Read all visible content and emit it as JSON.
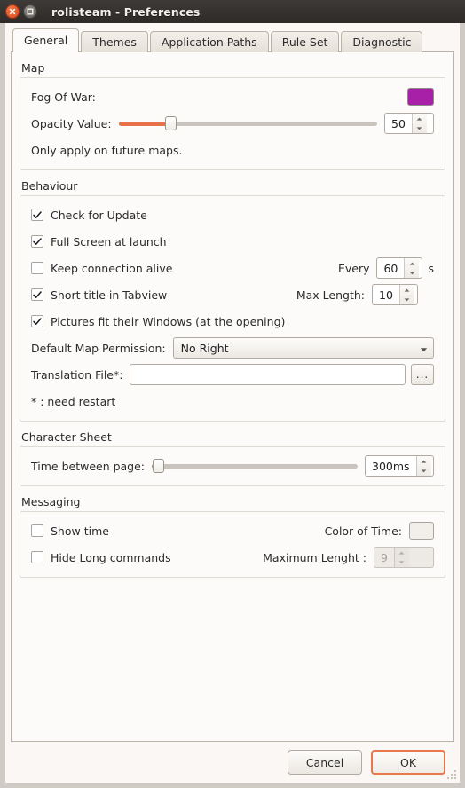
{
  "window": {
    "title": "rolisteam - Preferences",
    "close_icon": "close-icon",
    "restore_icon": "restore-icon"
  },
  "tabs": [
    {
      "label": "General",
      "active": true
    },
    {
      "label": "Themes",
      "active": false
    },
    {
      "label": "Application Paths",
      "active": false
    },
    {
      "label": "Rule Set",
      "active": false
    },
    {
      "label": "Diagnostic",
      "active": false
    }
  ],
  "colors": {
    "fog_of_war": "#a81fa8",
    "color_of_time": "#f2efeb",
    "slider_fill": "#e8714a",
    "default_button_border": "#e8794f"
  },
  "map": {
    "group_title": "Map",
    "fog_of_war_label": "Fog Of War:",
    "opacity_label": "Opacity Value:",
    "opacity_value": "50",
    "opacity_percent": 20,
    "note": "Only apply on future maps."
  },
  "behaviour": {
    "group_title": "Behaviour",
    "check_for_update": {
      "label": "Check for Update",
      "checked": true
    },
    "full_screen": {
      "label": "Full Screen at launch",
      "checked": true
    },
    "keep_alive": {
      "label": "Keep connection alive",
      "checked": false
    },
    "keep_alive_every_label": "Every",
    "keep_alive_value": "60",
    "keep_alive_unit": "s",
    "short_title": {
      "label": "Short title in Tabview",
      "checked": true
    },
    "max_length_label": "Max Length:",
    "max_length_value": "10",
    "pictures_fit": {
      "label": "Pictures fit their Windows (at the opening)",
      "checked": true
    },
    "permission_label": "Default Map Permission:",
    "permission_value": "No Right",
    "permission_options": [
      "No Right"
    ],
    "translation_label": "Translation File*:",
    "translation_value": "",
    "translation_placeholder": "",
    "browse_label": "...",
    "restart_note": "* : need restart"
  },
  "character_sheet": {
    "group_title": "Character Sheet",
    "time_label": "Time between page:",
    "time_value": "300ms",
    "time_percent": 3
  },
  "messaging": {
    "group_title": "Messaging",
    "show_time": {
      "label": "Show time",
      "checked": false
    },
    "color_of_time_label": "Color of Time:",
    "hide_long_commands": {
      "label": "Hide Long commands",
      "checked": false
    },
    "maximum_length_label": "Maximum Lenght :",
    "maximum_length_value": "9",
    "maximum_length_disabled": true
  },
  "footer": {
    "cancel": {
      "pre": "",
      "accel": "C",
      "post": "ancel"
    },
    "ok": {
      "pre": "",
      "accel": "O",
      "post": "K"
    }
  }
}
